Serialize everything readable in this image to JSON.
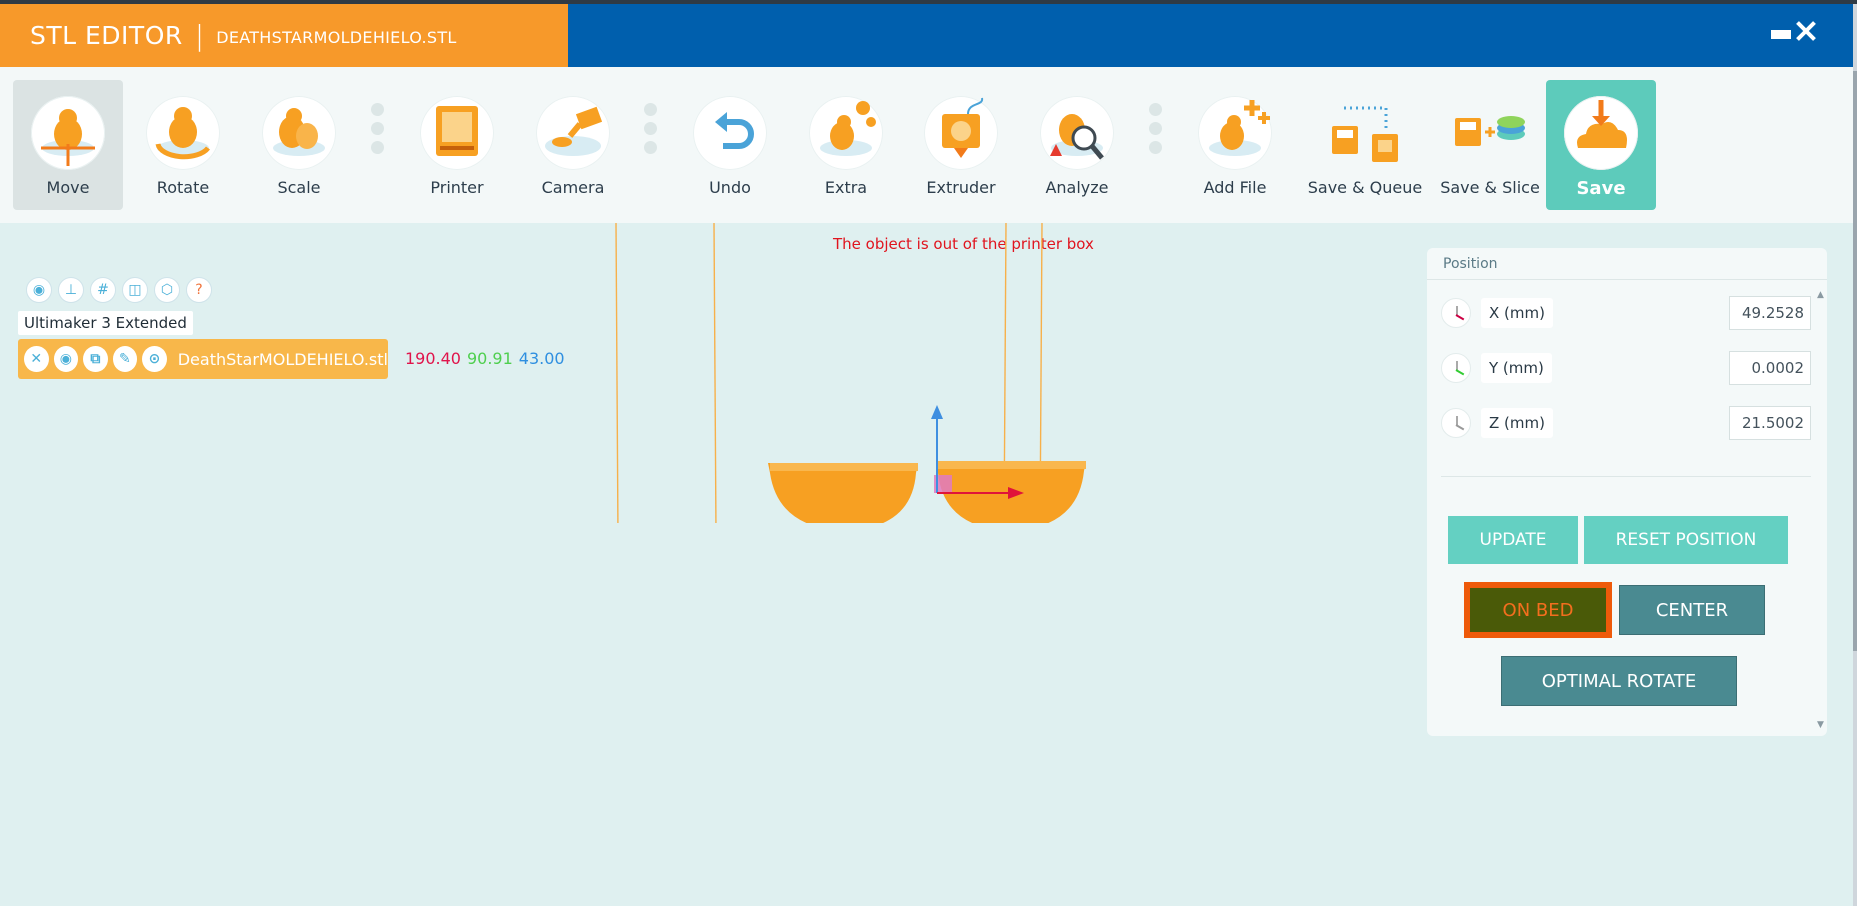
{
  "title": {
    "app": "STL EDITOR",
    "separator": "|",
    "file": "DEATHSTARMOLDEHIELO.STL"
  },
  "window_controls": {
    "minimize": "minimize-icon",
    "close": "close-icon"
  },
  "toolbar": {
    "items": [
      {
        "label": "Move",
        "icon": "move-icon",
        "active": true
      },
      {
        "label": "Rotate",
        "icon": "rotate-icon"
      },
      {
        "label": "Scale",
        "icon": "scale-icon"
      },
      {
        "label": "Printer",
        "icon": "printer-icon"
      },
      {
        "label": "Camera",
        "icon": "camera-icon"
      },
      {
        "label": "Undo",
        "icon": "undo-icon"
      },
      {
        "label": "Extra",
        "icon": "extra-icon"
      },
      {
        "label": "Extruder",
        "icon": "extruder-icon"
      },
      {
        "label": "Analyze",
        "icon": "analyze-icon"
      },
      {
        "label": "Add File",
        "icon": "add-file-icon"
      },
      {
        "label": "Save & Queue",
        "icon": "save-queue-icon"
      },
      {
        "label": "Save & Slice",
        "icon": "save-slice-icon"
      },
      {
        "label": "Save",
        "icon": "save-cloud-icon"
      }
    ]
  },
  "viewport": {
    "warning": "The object is out of the printer box",
    "printer_name": "Ultimaker 3 Extended",
    "model": {
      "name": "DeathStarMOLDEHIELO.stl",
      "dims": {
        "x": "190.40",
        "y": "90.91",
        "z": "43.00"
      }
    }
  },
  "position_panel": {
    "title": "Position",
    "x_label": "X (mm)",
    "x_value": "49.2528",
    "y_label": "Y (mm)",
    "y_value": "0.0002",
    "z_label": "Z (mm)",
    "z_value": "21.5002",
    "update": "UPDATE",
    "reset": "RESET POSITION",
    "on_bed": "ON BED",
    "center": "CENTER",
    "optimal_rotate": "OPTIMAL ROTATE"
  },
  "colors": {
    "orange": "#f7992a",
    "blue": "#005fad",
    "teal": "#64d0c2",
    "dark_teal": "#4a8a91",
    "warning": "#e0141e"
  }
}
